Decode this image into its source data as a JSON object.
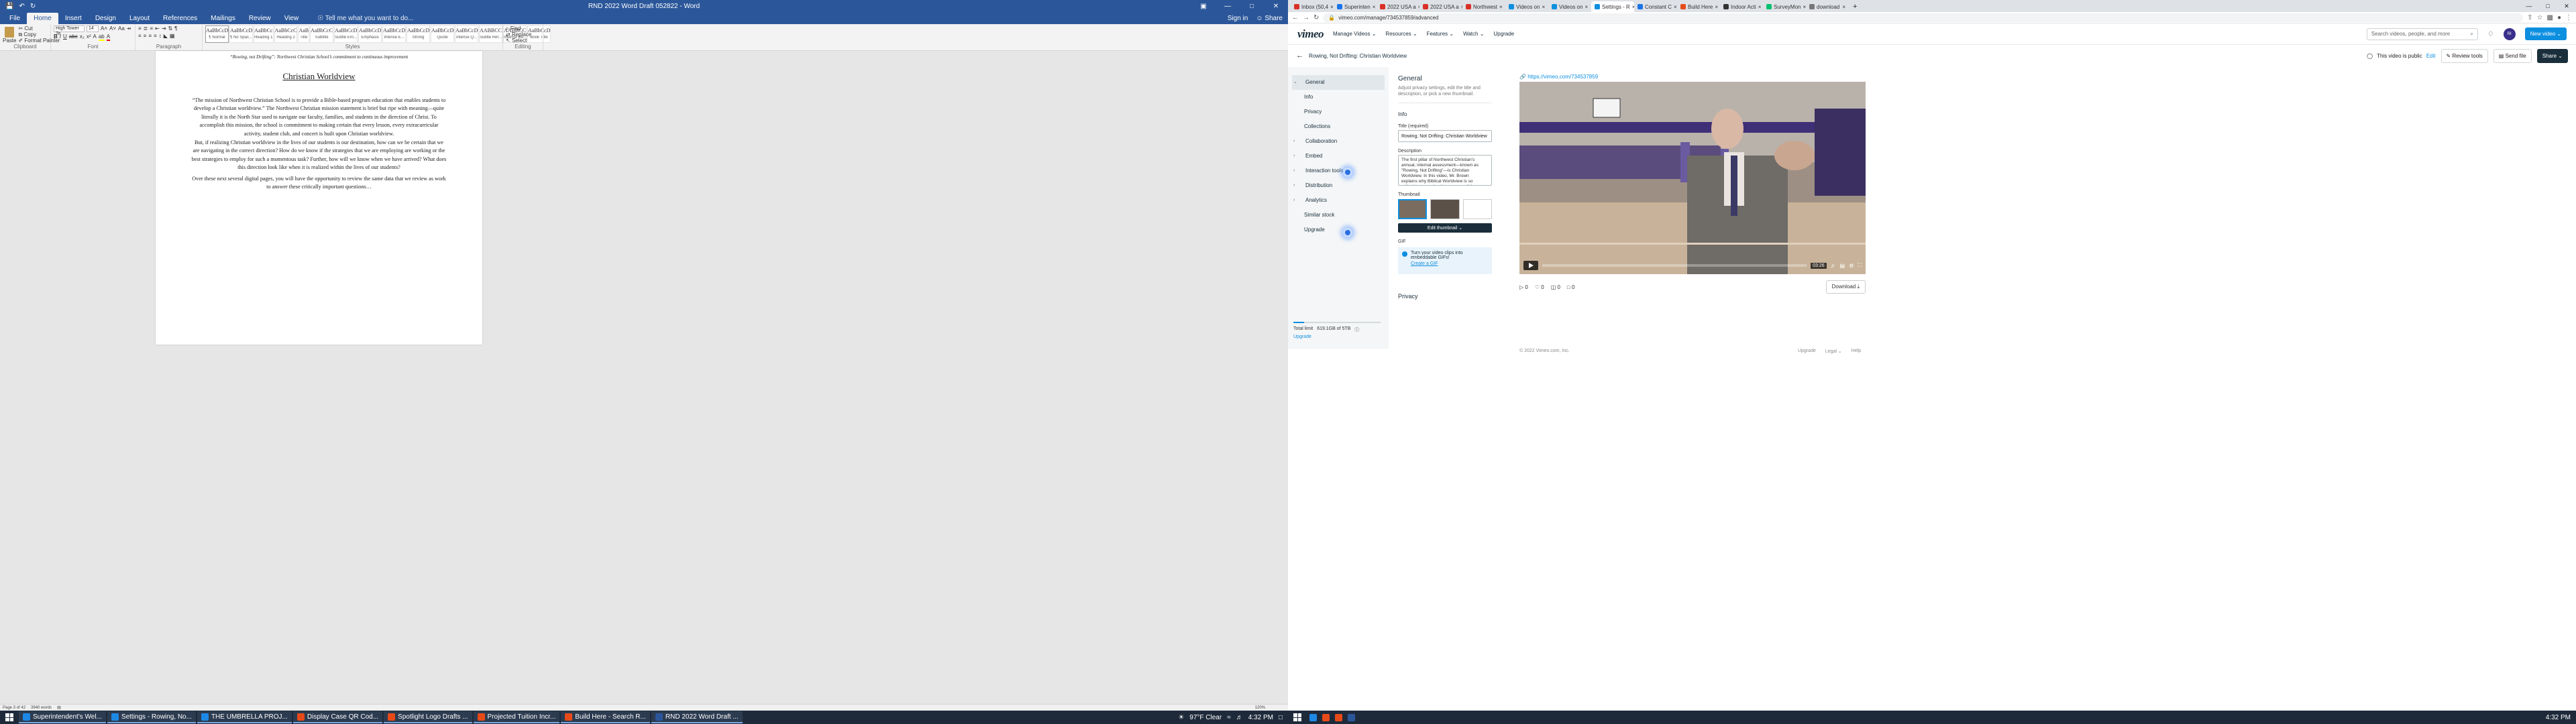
{
  "word": {
    "doc_title": "RND 2022 Word Draft 052822 - Word",
    "tabs": [
      "File",
      "Home",
      "Insert",
      "Design",
      "Layout",
      "References",
      "Mailings",
      "Review",
      "View"
    ],
    "active_tab": "Home",
    "tell_me": "Tell me what you want to do...",
    "sign_in": "Sign in",
    "share": "Share",
    "clipboard": {
      "paste": "Paste",
      "cut": "Cut",
      "copy": "Copy",
      "format_painter": "Format Painter",
      "label": "Clipboard"
    },
    "font": {
      "name": "High Tower Te",
      "size": "14",
      "label": "Font"
    },
    "paragraph_label": "Paragraph",
    "styles_label": "Styles",
    "styles": [
      {
        "ex": "AaBbCcDc",
        "name": "¶ Normal"
      },
      {
        "ex": "AaBbCcDc",
        "name": "¶ No Spac..."
      },
      {
        "ex": "AaBbCc",
        "name": "Heading 1"
      },
      {
        "ex": "AaBbCcC",
        "name": "Heading 2"
      },
      {
        "ex": "AaB",
        "name": "Title"
      },
      {
        "ex": "AaBbCcC",
        "name": "Subtitle"
      },
      {
        "ex": "AaBbCcDc",
        "name": "Subtle Em..."
      },
      {
        "ex": "AaBbCcDc",
        "name": "Emphasis"
      },
      {
        "ex": "AaBbCcDc",
        "name": "Intense E..."
      },
      {
        "ex": "AaBbCcDc",
        "name": "Strong"
      },
      {
        "ex": "AaBbCcDc",
        "name": "Quote"
      },
      {
        "ex": "AaBbCcDc",
        "name": "Intense Q..."
      },
      {
        "ex": "AABBCCDC",
        "name": "Subtle Ref..."
      },
      {
        "ex": "AABBCCDC",
        "name": "Intense Re..."
      },
      {
        "ex": "AaBbCcDc",
        "name": "Book Title"
      }
    ],
    "editing": {
      "find": "Find",
      "replace": "Replace",
      "select": "Select",
      "label": "Editing"
    },
    "page": {
      "header": "“Rowing, not Drifting”:  Northwest Christian School’s commitment to continuous improvement",
      "heading": "Christian Worldview",
      "p1": "“The mission of Northwest Christian School is to provide a Bible-based program education that enables students to develop a Christian worldview.”  The Northwest Christian mission statement is brief but ripe with meaning—quite literally it is the North Star used to navigate our faculty, families, and students in the direction of Christ.  To accomplish this mission, the school is commitment to making certain that every lesson, every extracurricular activity, student club, and concert is built upon Christian worldview.",
      "p2": "But, if realizing Christian worldview in the lives of our students is our destination, how can we be certain that we are navigating in the correct direction?  How do we know if the strategies that we are employing are working or the best strategies to employ for such a momentous task?  Further, how will we know when we have arrived?  What does this direction look like when it is realized within the lives of our students?",
      "p3": "Over these next several digital pages, you will have the opportunity to review the same data that we review as work to answer these critically important questions…"
    },
    "status": {
      "page": "Page 3 of 42",
      "words": "3940 words",
      "zoom": "120%"
    }
  },
  "taskbar_left": {
    "apps": [
      {
        "label": "Superintendent's Wel...",
        "color": "#1e88e5"
      },
      {
        "label": "Settings - Rowing, No...",
        "color": "#1e88e5"
      },
      {
        "label": "THE UMBRELLA PROJ...",
        "color": "#1e88e5"
      },
      {
        "label": "Display Case QR Cod...",
        "color": "#e64a19"
      },
      {
        "label": "Spotlight Logo Drafts ...",
        "color": "#e64a19"
      },
      {
        "label": "Projected Tuition Incr...",
        "color": "#e64a19"
      },
      {
        "label": "Build Here - Search R...",
        "color": "#e64a19"
      },
      {
        "label": "RND 2022 Word Draft ...",
        "color": "#2b579a"
      }
    ],
    "weather": "97°F  Clear",
    "time": "4:32 PM"
  },
  "taskbar_right": {
    "time": "4:32 PM"
  },
  "chrome": {
    "tabs": [
      {
        "label": "Inbox (50,4",
        "color": "#d93025"
      },
      {
        "label": "Superinten",
        "color": "#1a73e8"
      },
      {
        "label": "2022 USA a",
        "color": "#d93025"
      },
      {
        "label": "2022 USA a",
        "color": "#d93025"
      },
      {
        "label": "Northwest",
        "color": "#d93025"
      },
      {
        "label": "Videos on",
        "color": "#0d8fe0"
      },
      {
        "label": "Videos on",
        "color": "#0d8fe0"
      },
      {
        "label": "Settings - R",
        "color": "#0d8fe0"
      },
      {
        "label": "Constant C",
        "color": "#1a73e8"
      },
      {
        "label": "Build Here",
        "color": "#e64a19"
      },
      {
        "label": "Indoor Acti",
        "color": "#333333"
      },
      {
        "label": "SurveyMon",
        "color": "#00bf6f"
      },
      {
        "label": "download",
        "color": "#777777"
      }
    ],
    "active_tab": 7,
    "url": "vimeo.com/manage/734537859/advanced"
  },
  "vimeo": {
    "logo": "vimeo",
    "nav": [
      "Manage Videos ⌄",
      "Resources ⌄",
      "Features ⌄",
      "Watch ⌄",
      "Upgrade"
    ],
    "search_placeholder": "Search videos, people, and more",
    "avatar": "RI",
    "new_video": "New video ⌄",
    "video_title": "Rowing, Not Drifting: Christian Worldview",
    "public_text": "This video is public",
    "edit": "Edit",
    "review_tools": "Review tools",
    "send_file": "Send file",
    "share": "Share ⌄",
    "sidebar": [
      {
        "label": "General",
        "top": true,
        "caret": "⌄",
        "active": true
      },
      {
        "label": "Info",
        "top": false
      },
      {
        "label": "Privacy",
        "top": false
      },
      {
        "label": "Collections",
        "top": false
      },
      {
        "label": "Collaboration",
        "top": true,
        "caret": "›"
      },
      {
        "label": "Embed",
        "top": true,
        "caret": "›"
      },
      {
        "label": "Interaction tools",
        "top": true,
        "caret": "›"
      },
      {
        "label": "Distribution",
        "top": true,
        "caret": "›"
      },
      {
        "label": "Analytics",
        "top": true,
        "caret": "›"
      },
      {
        "label": "Similar stock",
        "top": false
      },
      {
        "label": "Upgrade",
        "top": false
      }
    ],
    "storage": {
      "label": "Total limit",
      "value": "619.1GB of 5TB",
      "upgrade": "Upgrade",
      "fraction": 0.12
    },
    "general": {
      "heading": "General",
      "sub": "Adjust privacy settings, edit the title and description, or pick a new thumbnail.",
      "info": "Info",
      "title_label": "Title (required)",
      "title_value": "Rowing, Not Drifting:  Christian Worldview",
      "description_label": "Description",
      "description": "The first pillar of Northwest Christian's annual, internal assessment—known as \"Rowing, Not Drifting\"—is Christian Worldview.  In this video, Mr. Brown explains why Biblical Worldview is so critical to assessing the success of the mission of the school.",
      "thumbnail_label": "Thumbnail",
      "edit_thumbnail": "Edit thumbnail ⌄",
      "gif_label": "GIF",
      "gif_text": "Turn your video clips into embeddable GIFs!",
      "create_gif": "Create a GIF",
      "privacy": "Privacy"
    },
    "player": {
      "link": "https://vimeo.com/734537859",
      "time": "03:26"
    },
    "stats": {
      "plays": "0",
      "likes": "0",
      "collections": "0",
      "comments": "0",
      "download": "Download"
    },
    "footer": {
      "copyright": "© 2022 Vimeo.com, Inc.",
      "links": [
        "Upgrade",
        "Legal ⌄",
        "Help"
      ]
    }
  }
}
